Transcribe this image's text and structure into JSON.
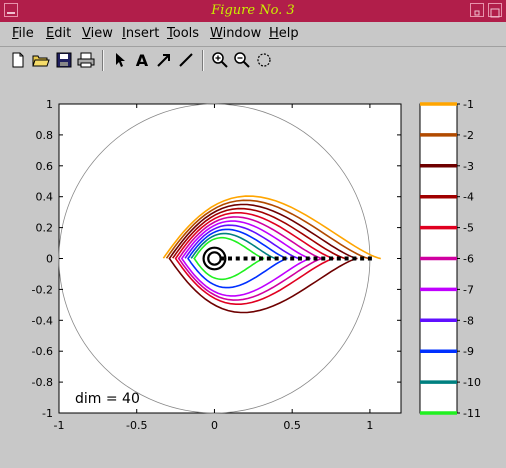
{
  "window": {
    "title": "Figure No. 3"
  },
  "menu": [
    {
      "label": "File",
      "u": "F",
      "rest": "ile"
    },
    {
      "label": "Edit",
      "u": "E",
      "rest": "dit"
    },
    {
      "label": "View",
      "u": "V",
      "rest": "iew"
    },
    {
      "label": "Insert",
      "u": "I",
      "rest": "nsert"
    },
    {
      "label": "Tools",
      "u": "T",
      "rest": "ools"
    },
    {
      "label": "Window",
      "u": "W",
      "rest": "indow"
    },
    {
      "label": "Help",
      "u": "H",
      "rest": "elp"
    }
  ],
  "toolbar": [
    "new-icon",
    "open-icon",
    "save-icon",
    "print-icon",
    "arrow-select-icon",
    "text-icon",
    "arrow-icon",
    "line-icon",
    "zoom-in-icon",
    "zoom-out-icon",
    "rotate-icon"
  ],
  "toolbar_text": {
    "text_tool": "A"
  },
  "plot": {
    "annotation": "dim = 40",
    "x_ticks": [
      "-1",
      "-0.5",
      "0",
      "0.5",
      "1"
    ],
    "y_ticks": [
      "1",
      "0.8",
      "0.6",
      "0.4",
      "0.2",
      "0",
      "-0.2",
      "-0.4",
      "-0.6",
      "-0.8",
      "-1"
    ]
  },
  "chart_data": {
    "type": "contour",
    "xlim": [
      -1,
      1.2
    ],
    "ylim": [
      -1,
      1
    ],
    "grid": false,
    "levels": [
      -1,
      -2,
      -3,
      -4,
      -5,
      -6,
      -7,
      -8,
      -9,
      -10,
      -11
    ],
    "level_colors": [
      "#ffa500",
      "#b14a00",
      "#6e0000",
      "#a00000",
      "#e00020",
      "#d000a0",
      "#c000ff",
      "#6010ff",
      "#0030ff",
      "#008080",
      "#20f020"
    ],
    "colorbar_labels": [
      "-1",
      "-2",
      "-3",
      "-4",
      "-5",
      "-6",
      "-7",
      "-8",
      "-9",
      "-10",
      "-11"
    ],
    "unit_circle": {
      "center": [
        0,
        0
      ],
      "radius": 1
    },
    "points": {
      "x": [
        0.05,
        0.1,
        0.15,
        0.2,
        0.25,
        0.3,
        0.35,
        0.4,
        0.45,
        0.5,
        0.55,
        0.6,
        0.65,
        0.7,
        0.75,
        0.8,
        0.85,
        0.9,
        0.95,
        1.0
      ],
      "y": 0
    },
    "source_circle": {
      "center": [
        0,
        0
      ],
      "radii": [
        0.04,
        0.07
      ]
    }
  }
}
